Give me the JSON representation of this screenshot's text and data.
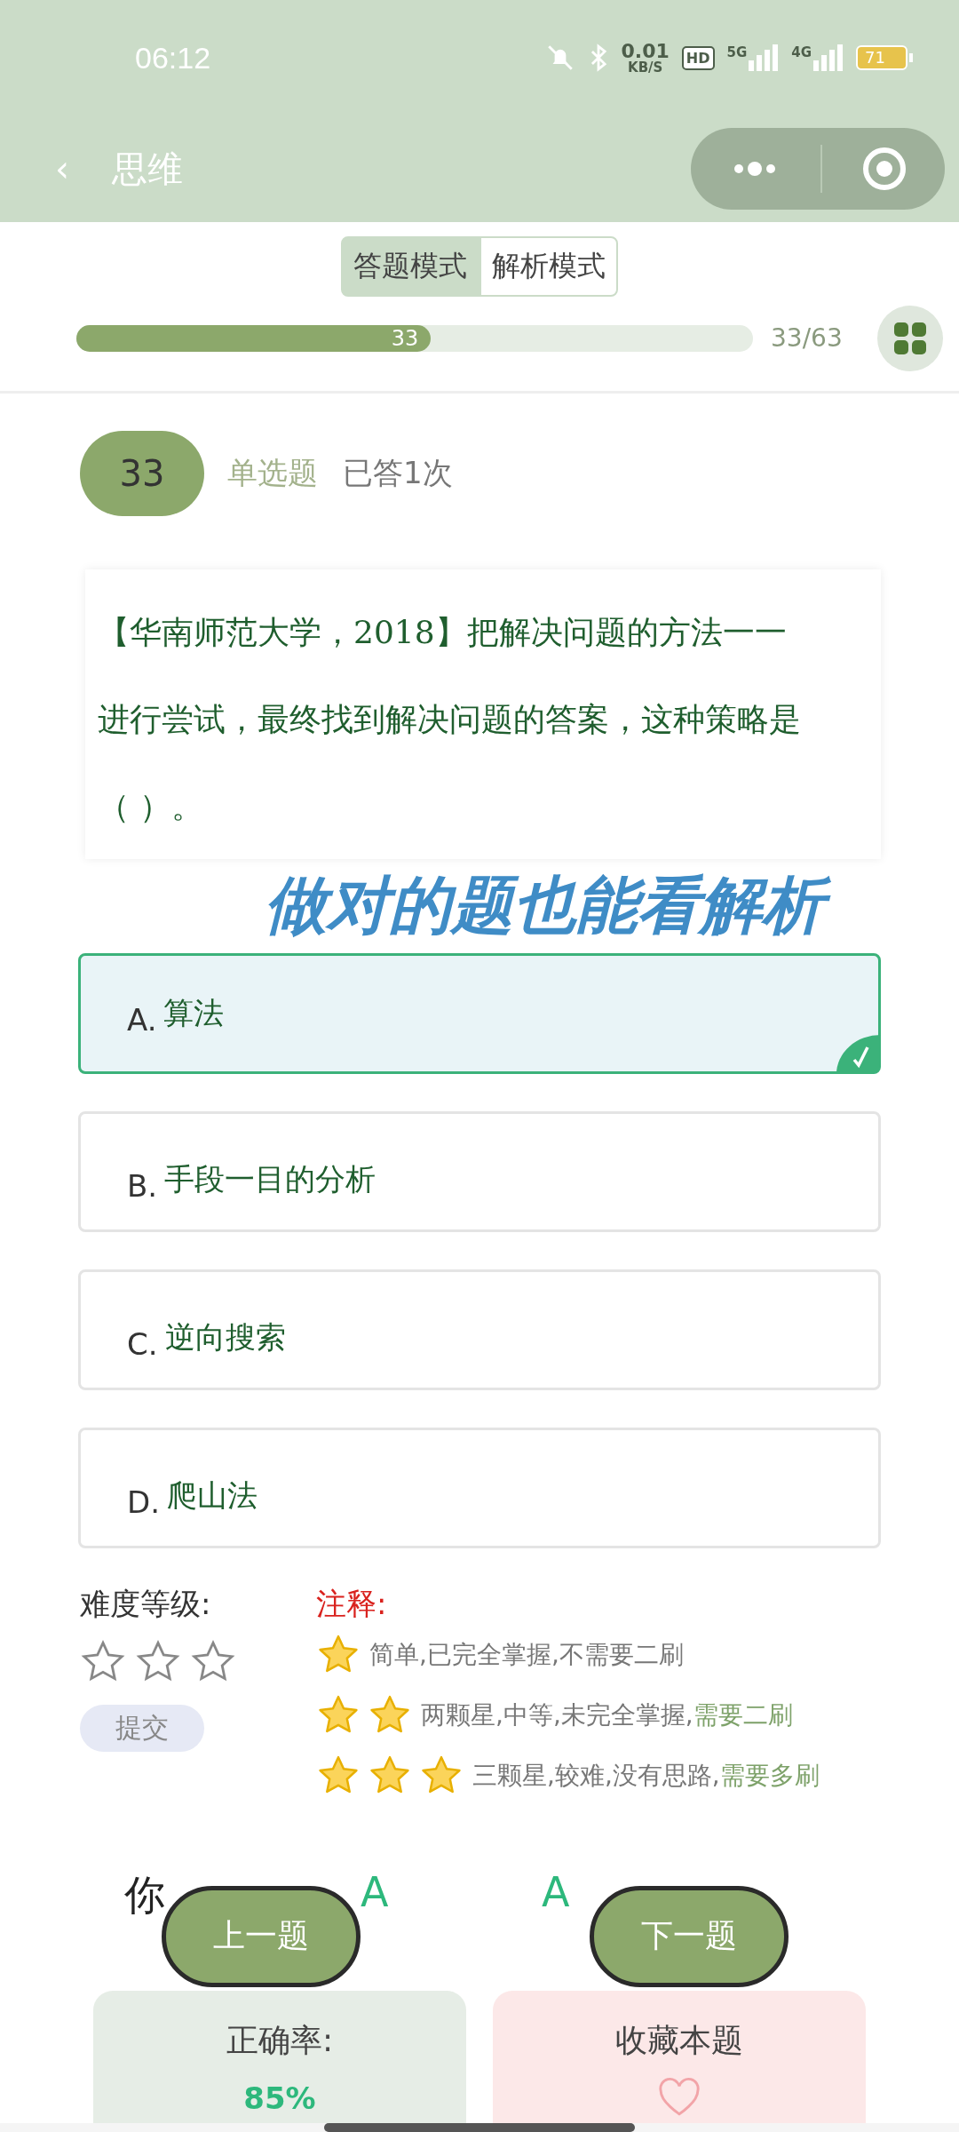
{
  "status_bar": {
    "time": "06:12",
    "speed_value": "0.01",
    "speed_unit": "KB/S",
    "hd": "HD",
    "net_5g": "5G",
    "net_4g": "4G",
    "battery": "71"
  },
  "header": {
    "back": "‹",
    "title": "思维"
  },
  "mode_tabs": [
    {
      "label": "答题模式",
      "selected": true
    },
    {
      "label": "解析模式",
      "selected": false
    }
  ],
  "progress": {
    "level": 0.524,
    "label": "33",
    "count": "33/63"
  },
  "question": {
    "number": "33",
    "type": "单选题",
    "answered": "已答1次",
    "text": "【华南师范大学，2018】把解决问题的方法一一进行尝试，最终找到解决问题的答案，这种策略是（ ）。"
  },
  "overlay_caption": "做对的题也能看解析",
  "options": [
    {
      "letter": "A.",
      "text": "算法",
      "selected": true
    },
    {
      "letter": "B.",
      "text": "手段一目的分析",
      "selected": false
    },
    {
      "letter": "C.",
      "text": "逆向搜索",
      "selected": false
    },
    {
      "letter": "D.",
      "text": "爬山法",
      "selected": false
    }
  ],
  "difficulty": {
    "label": "难度等级:",
    "stars": 0,
    "submit": "提交"
  },
  "legend": {
    "title": "注释:",
    "rows": [
      {
        "kind": "one",
        "text": "简单,已完全掌握,不需要二刷"
      },
      {
        "kind": "two",
        "text": "两颗星,中等,未完全掌握,",
        "highlight": "需要二刷"
      },
      {
        "kind": "three",
        "text": "三颗星,较难,没有思路,",
        "highlight": "需要多刷"
      }
    ]
  },
  "answers": {
    "yours_visible": "你",
    "yours": "A",
    "correct": "A"
  },
  "nav": {
    "prev": "上一题",
    "next": "下一题"
  },
  "cards": {
    "accuracy_label": "正确率:",
    "accuracy": "85%",
    "favorite": "收藏本题"
  }
}
